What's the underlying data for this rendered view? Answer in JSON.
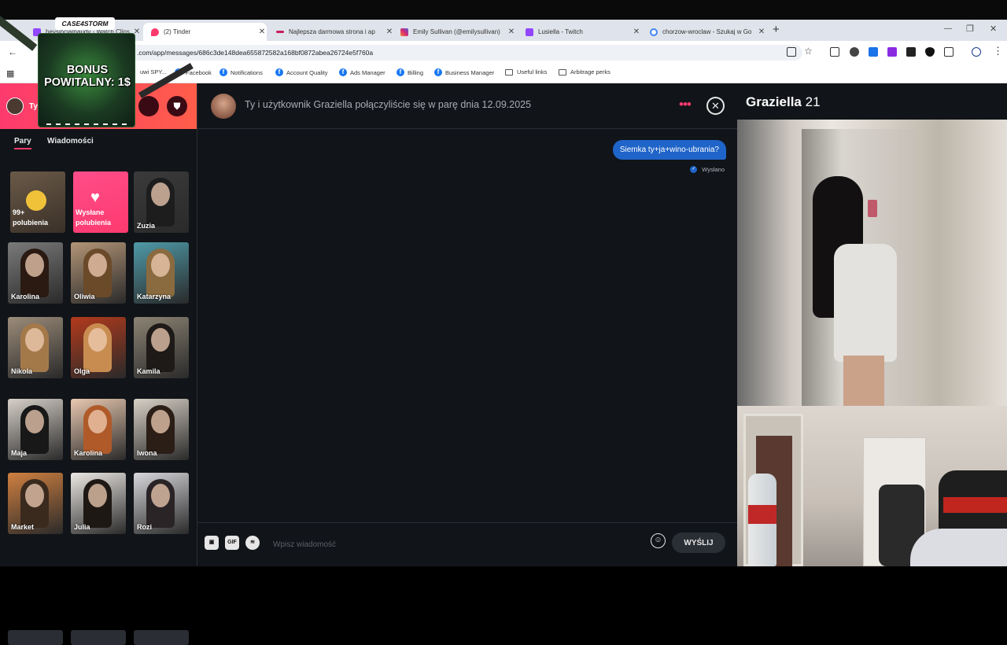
{
  "browser": {
    "tabs": [
      {
        "title": "heysinciamaudy - Watch Clips",
        "favicon_color": "#9146ff",
        "active": false
      },
      {
        "title": "(2) Tinder",
        "favicon_color": "#fd3a6e",
        "active": true
      },
      {
        "title": "Najlepsza darmowa strona i ap",
        "favicon_color": "#c81e5a",
        "active": false
      },
      {
        "title": "Emily Sullivan (@emilysullivan)",
        "favicon_color": "#d62976",
        "active": false
      },
      {
        "title": "Lusiella - Twitch",
        "favicon_color": "#9146ff",
        "active": false
      },
      {
        "title": "chorzow-wroclaw - Szukaj w Go",
        "favicon_color": "#4285f4",
        "active": false
      }
    ],
    "new_tab_label": "+",
    "url": ".com/app/messages/686c3de148dea655872582a168bf0872abea26724e5f760a",
    "bookmarks": [
      {
        "label": "uwi SPY...",
        "type": "text"
      },
      {
        "label": "Facebook",
        "type": "fb"
      },
      {
        "label": "Notifications",
        "type": "fb"
      },
      {
        "label": "Account Quality",
        "type": "fb"
      },
      {
        "label": "Ads Manager",
        "type": "fb"
      },
      {
        "label": "Billing",
        "type": "fb"
      },
      {
        "label": "Business Manager",
        "type": "fb"
      },
      {
        "label": "Useful links",
        "type": "folder"
      },
      {
        "label": "Arbitrage perks",
        "type": "folder"
      }
    ]
  },
  "sidebar": {
    "user_label": "Ty",
    "tabs": [
      {
        "label": "Pary",
        "selected": true
      },
      {
        "label": "Wiadomości",
        "selected": false
      }
    ],
    "likes_card": {
      "count": "99+",
      "label": "polubienia"
    },
    "sent_card": {
      "label": "Wysłane polubienia"
    },
    "matches": [
      {
        "name": "Zuzia",
        "hair": "#1d1d1d",
        "bg": "#3a3a3a"
      },
      {
        "name": "Karolina",
        "hair": "#2a1a12",
        "bg": "#7a7a7a"
      },
      {
        "name": "Oliwia",
        "hair": "#6b4a2a",
        "bg": "#b39577"
      },
      {
        "name": "Katarzyna",
        "hair": "#8a6a3f",
        "bg": "#4f9aa8"
      },
      {
        "name": "Nikola",
        "hair": "#a4794a",
        "bg": "#9c8c7a"
      },
      {
        "name": "Olga",
        "hair": "#c88c50",
        "bg": "#b23a1c"
      },
      {
        "name": "Kamila",
        "hair": "#1e1a18",
        "bg": "#8c8474"
      },
      {
        "name": "Maja",
        "hair": "#181818",
        "bg": "#d6d0c8"
      },
      {
        "name": "Karolina",
        "hair": "#b05a2a",
        "bg": "#e8c8b0"
      },
      {
        "name": "Iwona",
        "hair": "#2a1e16",
        "bg": "#d8d0c6"
      },
      {
        "name": "Market",
        "hair": "#3a2a1e",
        "bg": "#d08040"
      },
      {
        "name": "Julia",
        "hair": "#1e1814",
        "bg": "#ece8e4"
      },
      {
        "name": "Rozi",
        "hair": "#2a2426",
        "bg": "#d8d8dc"
      }
    ]
  },
  "chat": {
    "match_text": "Ty i użytkownik Graziella połączyliście się w parę dnia 12.09.2025",
    "messages": [
      {
        "text": "Siemka ty+ja+wino-ubrania?",
        "status": "Wysłano"
      }
    ],
    "input_placeholder": "Wpisz wiadomość",
    "send_label": "WYŚLIJ",
    "gif_label": "GIF"
  },
  "profile": {
    "name": "Graziella",
    "age": "21"
  },
  "overlay": {
    "promo_text": "BONUS POWITALNY: 1$",
    "brand": "CASE4STORM"
  }
}
